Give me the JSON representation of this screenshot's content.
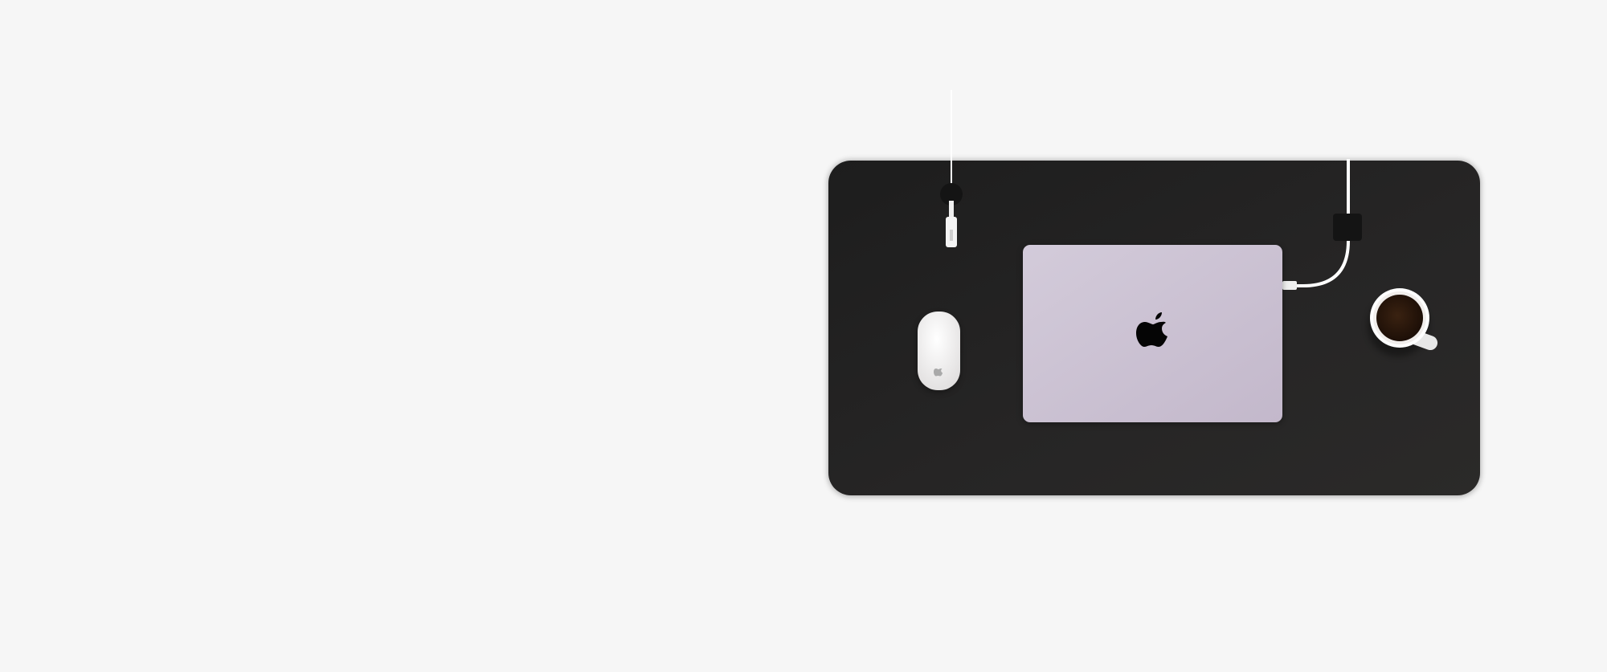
{
  "scene": {
    "background_color": "#f6f6f6",
    "desk_color": "#232222",
    "laptop_color": "#cbc1d2",
    "mouse_color": "#f2f1f1",
    "cable_color": "#ffffff",
    "coffee_color": "#2a170c",
    "cup_color": "#ffffff",
    "icons": [
      "desk-pad",
      "laptop",
      "apple-logo-icon",
      "magic-mouse",
      "charging-cable",
      "cable-clip",
      "coffee-cup"
    ]
  }
}
